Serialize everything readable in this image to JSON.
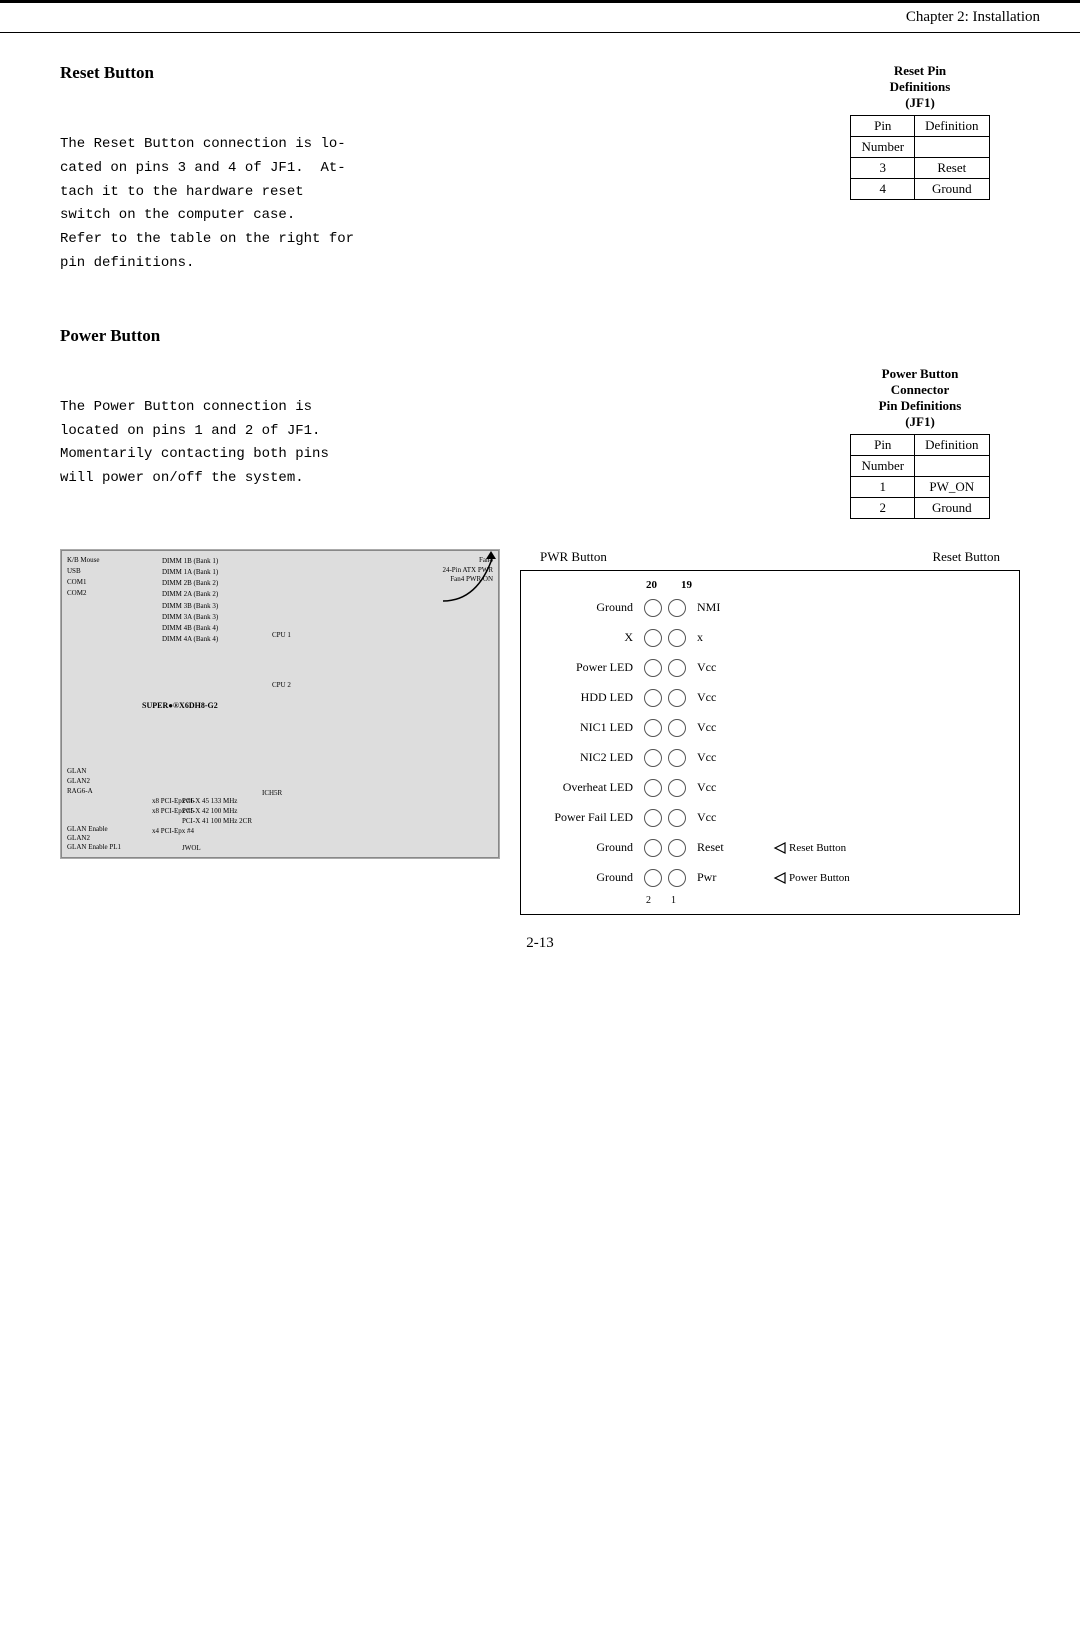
{
  "header": {
    "text": "Chapter 2: Installation"
  },
  "reset_button": {
    "title": "Reset Button",
    "body": "The Reset Button connection is lo-\ncated on pins 3 and 4 of JF1.  At-\ntach it to the hardware reset\nswitch on the computer case.\nRefer to the table on the right for\npin definitions.",
    "table_title1": "Reset Pin",
    "table_title2": "Definitions",
    "table_title3": "(JF1)",
    "table_header_col1": "Pin",
    "table_header_col2": "Number",
    "table_header_col3": "Definition",
    "table_rows": [
      {
        "num": "3",
        "def": "Reset"
      },
      {
        "num": "4",
        "def": "Ground"
      }
    ]
  },
  "power_button": {
    "title": "Power Button",
    "body": "The Power Button connection is\nlocated on pins 1 and 2 of JF1.\nMomentarily contacting both pins\nwill power on/off the system.",
    "table_title1": "Power Button",
    "table_title2": "Connector",
    "table_title3": "Pin Definitions",
    "table_title4": "(JF1)",
    "table_header_col1": "Pin",
    "table_header_col2": "Number",
    "table_header_col3": "Definition",
    "table_rows": [
      {
        "num": "1",
        "def": "PW_ON"
      },
      {
        "num": "2",
        "def": "Ground"
      }
    ]
  },
  "diagram": {
    "pwr_label": "PWR  Button",
    "reset_label": "Reset  Button",
    "col_nums": [
      "20",
      "19"
    ],
    "rows": [
      {
        "left": "Ground",
        "right": "NMI"
      },
      {
        "left": "X",
        "right": "x"
      },
      {
        "left": "Power LED",
        "right": "Vcc"
      },
      {
        "left": "HDD LED",
        "right": "Vcc"
      },
      {
        "left": "NIC1 LED",
        "right": "Vcc"
      },
      {
        "left": "NIC2 LED",
        "right": "Vcc"
      },
      {
        "left": "Overheat LED",
        "right": "Vcc"
      },
      {
        "left": "Power Fail LED",
        "right": "Vcc"
      },
      {
        "left": "Ground",
        "right": "Reset",
        "badge": "Reset Button"
      },
      {
        "left": "Ground",
        "right": "Pwr",
        "badge": "Power Button"
      }
    ]
  },
  "footer": {
    "page": "2-13"
  }
}
